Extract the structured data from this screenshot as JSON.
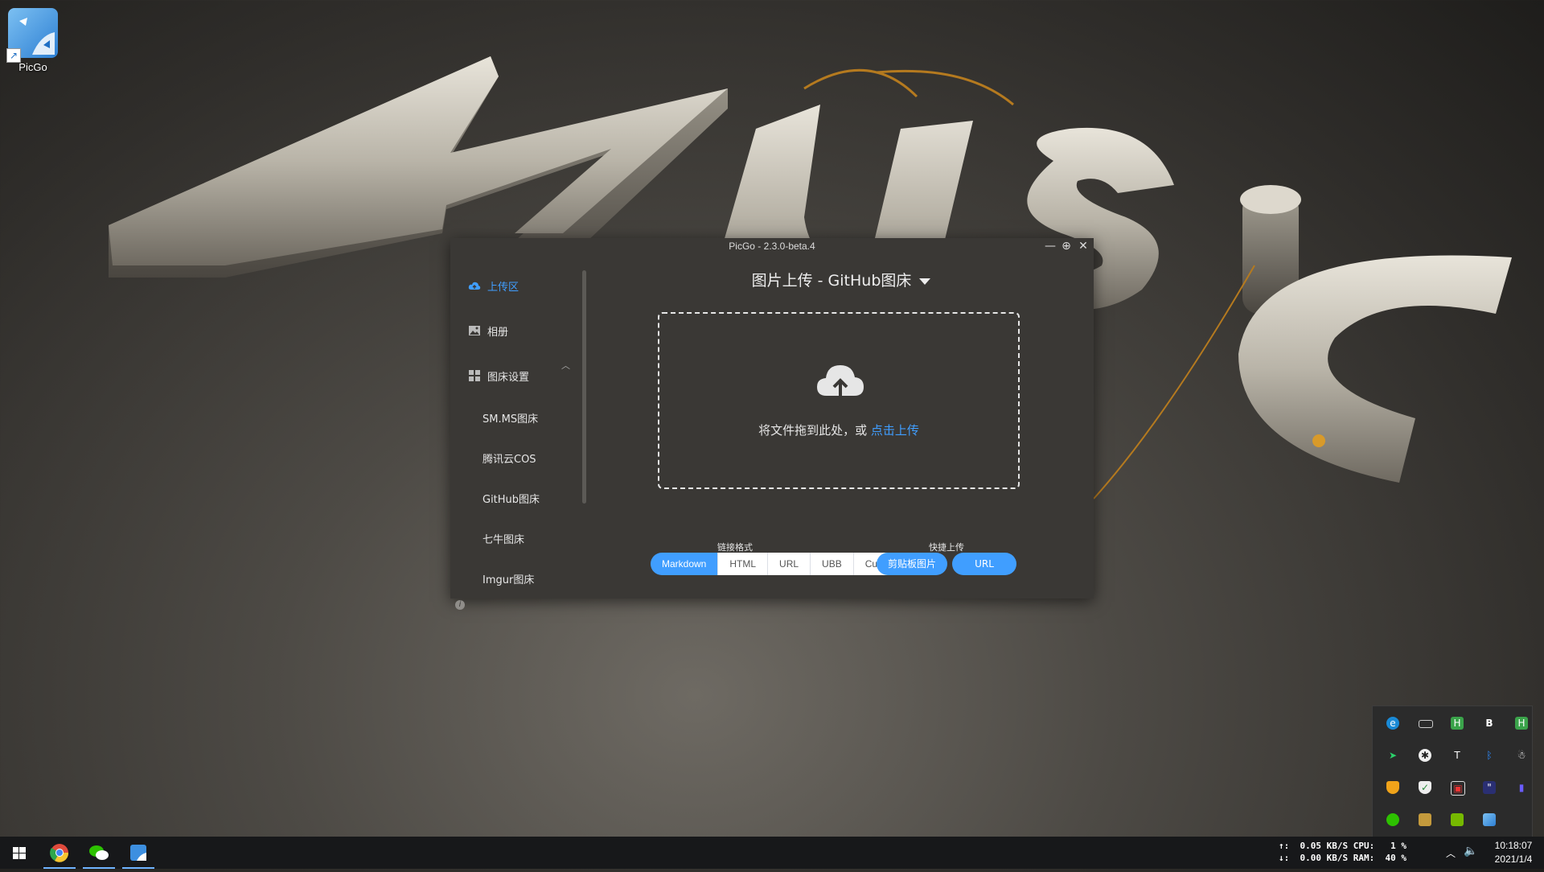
{
  "desktop": {
    "icons": [
      {
        "label": "PicGo",
        "icon": "picgo-app-icon"
      }
    ]
  },
  "window": {
    "title": "PicGo - 2.3.0-beta.4",
    "controls": {
      "minimize": "—",
      "maximize": "⊕",
      "close": "✕"
    }
  },
  "sidebar": {
    "items": [
      {
        "label": "上传区",
        "icon": "cloud-upload-icon",
        "active": true
      },
      {
        "label": "相册",
        "icon": "image-icon"
      },
      {
        "label": "图床设置",
        "icon": "grid-icon"
      }
    ],
    "subitems": [
      "SM.MS图床",
      "腾讯云COS",
      "GitHub图床",
      "七牛图床",
      "Imgur图床"
    ],
    "info": "i"
  },
  "upload": {
    "heading": "图片上传 - GitHub图床",
    "drop_hint": "将文件拖到此处，或",
    "drop_link": "点击上传",
    "link_format_label": "链接格式",
    "link_formats": [
      "Markdown",
      "HTML",
      "URL",
      "UBB",
      "Custom"
    ],
    "selected_format": "Markdown",
    "quick_upload_label": "快捷上传",
    "quick_clipboard": "剪贴板图片",
    "quick_url": "URL"
  },
  "tray_overflow": {
    "icons": [
      "edge-icon",
      "keyboard-icon",
      "hbuilder-icon",
      "typora-icon",
      "green-h-icon",
      "send-arrow-icon",
      "activity-icon",
      "font-size-icon",
      "bluetooth-icon",
      "qq-penguin-icon",
      "security-shield-icon",
      "wechat-shield-icon",
      "window-app-icon",
      "quote-icon",
      "audio-bars-icon",
      "wechat-icon",
      "image-app-icon",
      "nvidia-icon",
      "picgo-tray-icon"
    ]
  },
  "taskbar": {
    "apps": [
      "windows-start-icon",
      "chrome-icon",
      "wechat-icon",
      "picgo-icon"
    ],
    "net": {
      "up_arrow": "↑:",
      "down_arrow": "↓:",
      "up_line": "0.05 KB/S CPU:   1 %",
      "down_line": "0.00 KB/S RAM:  40 %"
    },
    "time": "10:18:07",
    "date": "2021/1/4"
  },
  "colors": {
    "accent": "#409eff",
    "window_bg": "#3a3835",
    "taskbar_bg": "#17181a"
  }
}
